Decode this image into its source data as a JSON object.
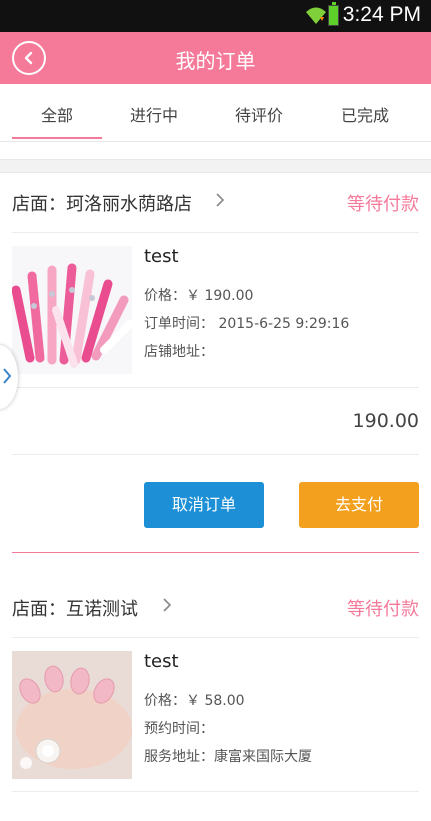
{
  "status_bar": {
    "time": "3:24 PM"
  },
  "header": {
    "title": "我的订单"
  },
  "tabs": [
    {
      "label": "全部",
      "active": true
    },
    {
      "label": "进行中",
      "active": false
    },
    {
      "label": "待评价",
      "active": false
    },
    {
      "label": "已完成",
      "active": false
    }
  ],
  "orders": [
    {
      "shop": "店面：珂洛丽水荫路店",
      "status": "等待付款",
      "product_name": "test",
      "lines": [
        "价格：￥ 190.00",
        "订单时间： 2015-6-25 9:29:16",
        "店铺地址："
      ],
      "total": "190.00",
      "buttons": {
        "cancel": "取消订单",
        "pay": "去支付"
      }
    },
    {
      "shop": "店面：互诺测试",
      "status": "等待付款",
      "product_name": "test",
      "lines": [
        "价格：￥ 58.00",
        "预约时间：",
        "服务地址：康富来国际大厦"
      ]
    }
  ],
  "colors": {
    "accent": "#f57a9a",
    "cancel_button": "#1c8fd6",
    "pay_button": "#f2a01e"
  },
  "icons": {
    "back": "chevron-left-circle-icon",
    "shop_link": "chevron-right-icon",
    "side_drawer": "chevron-right-icon"
  }
}
